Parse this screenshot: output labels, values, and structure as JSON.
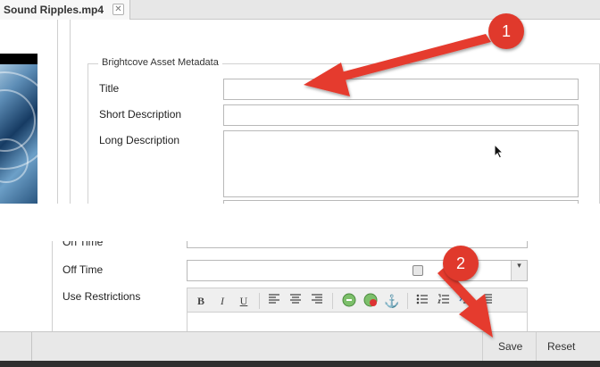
{
  "tab": {
    "label": "Sound Ripples.mp4",
    "close_glyph": "✕"
  },
  "metadata": {
    "legend": "Brightcove Asset Metadata",
    "title_label": "Title",
    "title_value": "",
    "short_desc_label": "Short Description",
    "short_desc_value": "",
    "long_desc_label": "Long Description",
    "long_desc_value": ""
  },
  "scheduling": {
    "cut_label": "On Time",
    "off_time_label": "Off Time",
    "off_time_value": "",
    "use_restrictions_label": "Use Restrictions",
    "dropdown_glyph": "▾"
  },
  "editor_toolbar": {
    "bold": "B",
    "italic": "I",
    "underline": "U",
    "anchor": "⚓"
  },
  "footer": {
    "save_label": "Save",
    "reset_label": "Reset"
  },
  "annotations": {
    "step1": "1",
    "step2": "2",
    "color": "#e0392c"
  },
  "colors": {
    "arrow": "#e53b2e",
    "footer_bg": "#e8e8e8"
  }
}
